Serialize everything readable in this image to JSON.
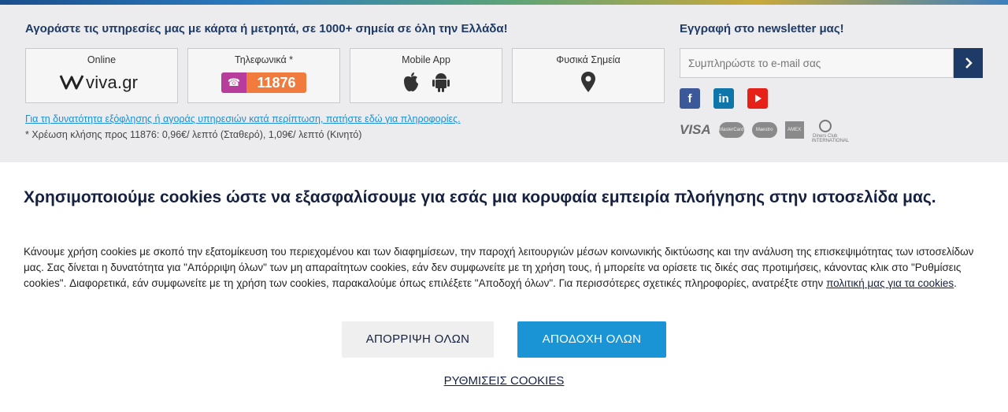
{
  "footer": {
    "buy_title": "Αγοράστε τις υπηρεσίες μας με κάρτα ή μετρητά, σε 1000+ σημεία σε όλη την Ελλάδα!",
    "cards": [
      {
        "label": "Online",
        "content": "viva.gr"
      },
      {
        "label": "Τηλεφωνικά *",
        "content": "11876"
      },
      {
        "label": "Mobile App"
      },
      {
        "label": "Φυσικά Σημεία"
      }
    ],
    "pay_link": "Για τη δυνατότητα εξόφλησης ή αγοράς υπηρεσιών κατά περίπτωση, πατήστε εδώ για πληροφορίες.",
    "call_note": "* Χρέωση κλήσης προς 11876: 0,96€/ λεπτό (Σταθερό), 1,09€/ λεπτό (Κινητό)",
    "newsletter_title": "Εγγραφή στο newsletter μας!",
    "newsletter_placeholder": "Συμπληρώστε το e-mail σας",
    "payment_cards": [
      "VISA",
      "MasterCard",
      "Maestro",
      "AMEX",
      "Diners Club INTERNATIONAL"
    ],
    "socials": [
      "facebook-icon",
      "linkedin-icon",
      "youtube-icon"
    ],
    "colors": {
      "facebook": "#3b5998",
      "linkedin": "#0e76a8",
      "youtube": "#e62117",
      "navy": "#1e3a66"
    }
  },
  "cookie": {
    "heading": "Χρησιμοποιούμε cookies ώστε να εξασφαλίσουμε για εσάς μια κορυφαία εμπειρία πλοήγησης στην ιστοσελίδα μας.",
    "body": "Κάνουμε χρήση cookies με σκοπό την εξατομίκευση του περιεχομένου και των διαφημίσεων, την παροχή λειτουργιών μέσων κοινωνικής δικτύωσης και την ανάλυση της επισκεψιμότητας των ιστοσελίδων μας. Σας δίνεται η δυνατότητα για \"Απόρριψη όλων\" των μη απαραίτητων cookies, εάν δεν συμφωνείτε με τη χρήση τους, ή μπορείτε να ορίσετε τις δικές σας προτιμήσεις, κάνοντας κλικ στο \"Ρυθμίσεις cookies\". Διαφορετικά, εάν συμφωνείτε με τη χρήση των cookies, παρακαλούμε όπως επιλέξετε \"Αποδοχή όλων\". Για περισσότερες σχετικές πληροφορίες, ανατρέξτε στην ",
    "policy_link": "πολιτική μας για τα cookies",
    "reject_label": "ΑΠΟΡΡΙΨΗ ΟΛΩΝ",
    "accept_label": "ΑΠΟΔΟΧΗ ΟΛΩΝ",
    "settings_label": "ΡΥΘΜΙΣΕΙΣ COOKIES",
    "colors": {
      "accept": "#1a94d4",
      "reject_bg": "#efefef",
      "heading": "#15213f"
    }
  }
}
